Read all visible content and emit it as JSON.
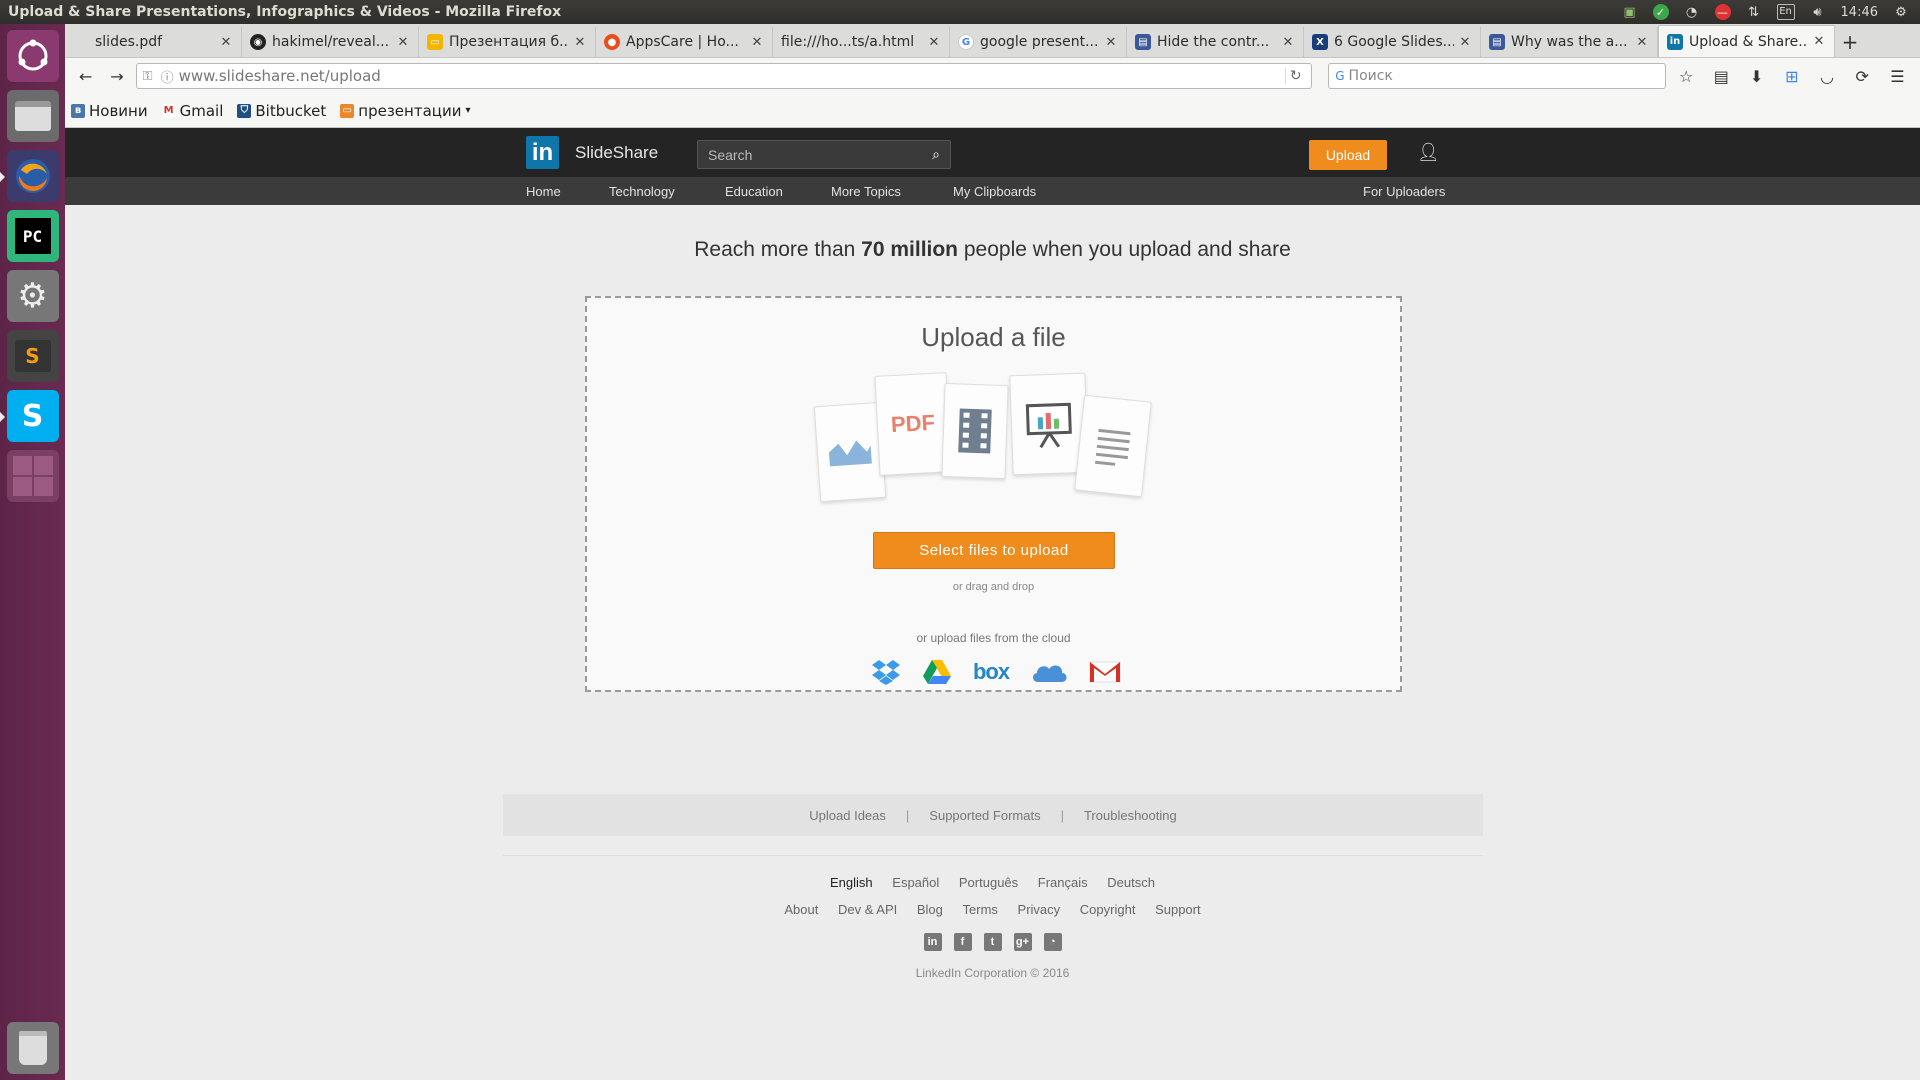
{
  "window": {
    "title": "Upload & Share Presentations, Infographics & Videos - Mozilla Firefox"
  },
  "tray": {
    "lang": "En",
    "time": "14:46"
  },
  "tabs": [
    {
      "label": "slides.pdf",
      "icon": "pdf-icon",
      "color": "#dcdcda"
    },
    {
      "label": "hakimel/reveal...",
      "icon": "github-icon",
      "color": "#222222"
    },
    {
      "label": "Презентация б...",
      "icon": "google-slides-icon",
      "color": "#f4b400"
    },
    {
      "label": "AppsCare | Ho...",
      "icon": "appscare-icon",
      "color": "#e94e1b"
    },
    {
      "label": "file:///ho...ts/a.html",
      "icon": "file-icon",
      "color": "#dcdcda"
    },
    {
      "label": "google present...",
      "icon": "google-icon",
      "color": "#4285f4"
    },
    {
      "label": "Hide the contr...",
      "icon": "doc-icon",
      "color": "#3b5998"
    },
    {
      "label": "6 Google Slides...",
      "icon": "x-icon",
      "color": "#1a3d7c"
    },
    {
      "label": "Why was the a...",
      "icon": "doc-icon",
      "color": "#3b5998"
    },
    {
      "label": "Upload & Share...",
      "icon": "linkedin-icon",
      "color": "#0e76a8"
    }
  ],
  "url": {
    "host": "www.slideshare.net",
    "path": "/upload"
  },
  "search_placeholder": "Поиск",
  "bookmarks": [
    {
      "label": "Новини",
      "icon": "vk-icon",
      "color": "#4a76a8"
    },
    {
      "label": "Gmail",
      "icon": "gmail-icon",
      "color": "#d93025"
    },
    {
      "label": "Bitbucket",
      "icon": "bitbucket-icon",
      "color": "#205081"
    },
    {
      "label": "презентации",
      "icon": "folder-icon",
      "color": "#e8872b"
    }
  ],
  "slideshare": {
    "logo_text": "SlideShare",
    "logo_mark": "in",
    "search_placeholder": "Search",
    "upload_label": "Upload",
    "nav": [
      "Home",
      "Technology",
      "Education",
      "More Topics",
      "My Clipboards"
    ],
    "nav_right": "For Uploaders",
    "headline_pre": "Reach more than ",
    "headline_bold": "70 million",
    "headline_post": " people when you upload and share",
    "dropzone": {
      "title": "Upload a file",
      "select_label": "Select files to upload",
      "drag_label": "or drag and drop",
      "cloud_label": "or upload files from the cloud",
      "cloud_providers": [
        "dropbox-icon",
        "google-drive-icon",
        "box-icon",
        "onedrive-icon",
        "gmail-icon"
      ]
    },
    "help_links": [
      "Upload Ideas",
      "Supported Formats",
      "Troubleshooting"
    ],
    "languages": [
      "English",
      "Español",
      "Português",
      "Français",
      "Deutsch"
    ],
    "footer_links": [
      "About",
      "Dev & API",
      "Blog",
      "Terms",
      "Privacy",
      "Copyright",
      "Support"
    ],
    "social": [
      "linkedin-icon",
      "facebook-icon",
      "twitter-icon",
      "googleplus-icon",
      "rss-icon"
    ],
    "copyright": "LinkedIn Corporation © 2016"
  },
  "colors": {
    "accent": "#f08c1e",
    "header": "#242424",
    "nav": "#3b3b3b",
    "launcher": "#5d2448"
  }
}
